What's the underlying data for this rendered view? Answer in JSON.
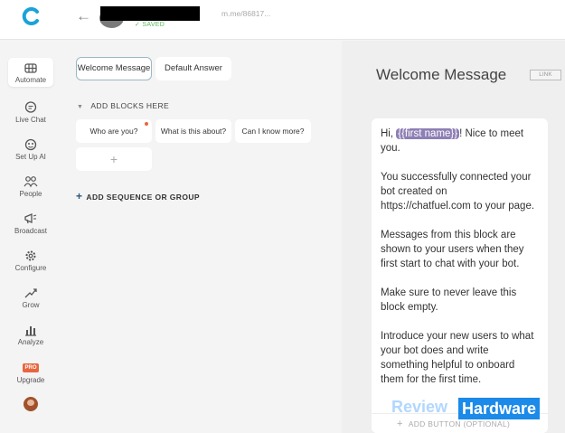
{
  "topbar": {
    "saved_label": "✓ SAVED",
    "bot_link": "m.me/86817..."
  },
  "sidebar": {
    "items": [
      {
        "label": "Automate"
      },
      {
        "label": "Live Chat"
      },
      {
        "label": "Set Up AI"
      },
      {
        "label": "People"
      },
      {
        "label": "Broadcast"
      },
      {
        "label": "Configure"
      },
      {
        "label": "Grow"
      },
      {
        "label": "Analyze"
      },
      {
        "label": "Upgrade"
      }
    ],
    "pro_badge": "PRO"
  },
  "middle": {
    "tabs": [
      {
        "label": "Welcome Message"
      },
      {
        "label": "Default Answer"
      }
    ],
    "add_blocks_label": "ADD BLOCKS HERE",
    "blocks": [
      {
        "label": "Who are you?"
      },
      {
        "label": "What is this about?"
      },
      {
        "label": "Can I know more?"
      }
    ],
    "add_block_plus": "+",
    "sequence_label": "ADD SEQUENCE OR GROUP"
  },
  "right": {
    "title": "Welcome Message",
    "link_label": "LINK",
    "card": {
      "greeting": "Hi, ",
      "attribute": "{{first name}}",
      "greeting_rest": "! Nice to meet you.",
      "p2": "You successfully connected your bot created on https://chatfuel.com to your page.",
      "p3": "Messages from this block are shown to your users when they first start to chat with your bot.",
      "p4": "Make sure to never leave this block empty.",
      "p5": "Introduce your new users to what your bot does and write something helpful to onboard them for the first time."
    },
    "add_button_label": "ADD BUTTON (OPTIONAL)"
  },
  "watermark": {
    "part1": "Review",
    "part2": "Hardware"
  },
  "colors": {
    "brand": "#1aa3d9",
    "accent": "#e8663f",
    "attribute_bg": "#8e7fb5"
  }
}
